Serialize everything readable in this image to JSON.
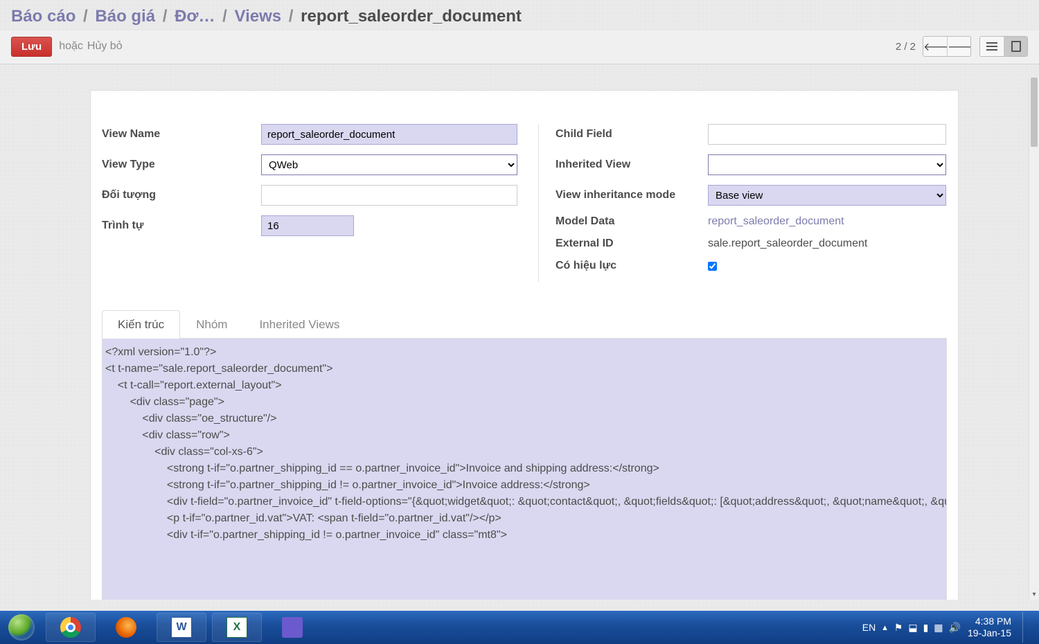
{
  "breadcrumb": {
    "items": [
      "Báo cáo",
      "Báo giá",
      "Đơ…",
      "Views"
    ],
    "current": "report_saleorder_document"
  },
  "toolbar": {
    "save": "Lưu",
    "or": "hoặc",
    "cancel": "Hủy bỏ",
    "pager": "2 / 2"
  },
  "form": {
    "left": {
      "view_name_label": "View Name",
      "view_name_value": "report_saleorder_document",
      "view_type_label": "View Type",
      "view_type_value": "QWeb",
      "object_label": "Đối tượng",
      "object_value": "",
      "sequence_label": "Trình tự",
      "sequence_value": "16"
    },
    "right": {
      "child_field_label": "Child Field",
      "child_field_value": "",
      "inherited_view_label": "Inherited View",
      "inherited_view_value": "",
      "inheritance_mode_label": "View inheritance mode",
      "inheritance_mode_value": "Base view",
      "model_data_label": "Model Data",
      "model_data_value": "report_saleorder_document",
      "external_id_label": "External ID",
      "external_id_value": "sale.report_saleorder_document",
      "active_label": "Có hiệu lực",
      "active_checked": true
    }
  },
  "tabs": {
    "arch": "Kiến trúc",
    "groups": "Nhóm",
    "inherited": "Inherited Views"
  },
  "arch_code": "<?xml version=\"1.0\"?>\n<t t-name=\"sale.report_saleorder_document\">\n    <t t-call=\"report.external_layout\">\n        <div class=\"page\">\n            <div class=\"oe_structure\"/>\n            <div class=\"row\">\n                <div class=\"col-xs-6\">\n                    <strong t-if=\"o.partner_shipping_id == o.partner_invoice_id\">Invoice and shipping address:</strong>\n                    <strong t-if=\"o.partner_shipping_id != o.partner_invoice_id\">Invoice address:</strong>\n                    <div t-field=\"o.partner_invoice_id\" t-field-options=\"{&quot;widget&quot;: &quot;contact&quot;, &quot;fields&quot;: [&quot;address&quot;, &quot;name&quot;, &quot;phone&quot;, &quot;fax&quot;], &quot;no_marker&quot;: true}\"/>\n                    <p t-if=\"o.partner_id.vat\">VAT: <span t-field=\"o.partner_id.vat\"/></p>\n                    <div t-if=\"o.partner_shipping_id != o.partner_invoice_id\" class=\"mt8\">",
  "taskbar": {
    "lang": "EN",
    "time": "4:38 PM",
    "date": "19-Jan-15"
  }
}
